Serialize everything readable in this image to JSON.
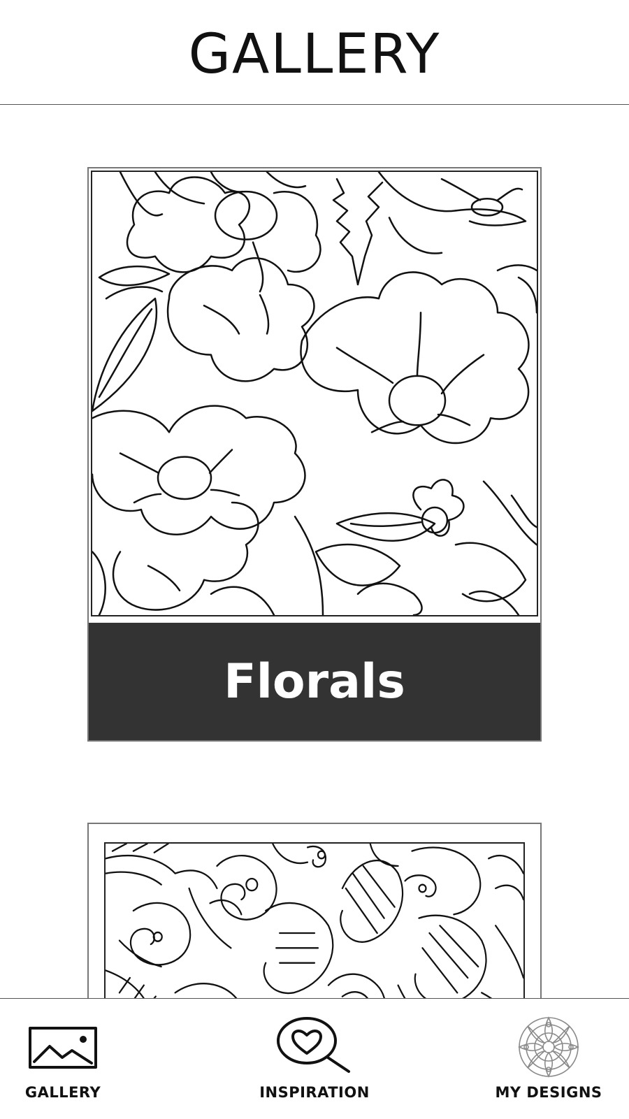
{
  "header": {
    "title": "GALLERY"
  },
  "gallery": {
    "cards": [
      {
        "label": "Florals",
        "icon": "florals-line-art"
      },
      {
        "label": "",
        "icon": "paisley-line-art"
      }
    ]
  },
  "bottom_nav": {
    "items": [
      {
        "label": "GALLERY",
        "icon": "gallery-image-icon"
      },
      {
        "label": "INSPIRATION",
        "icon": "heart-magnifier-icon"
      },
      {
        "label": "MY DESIGNS",
        "icon": "mandala-icon"
      }
    ]
  },
  "colors": {
    "label_background": "#333333",
    "label_text": "#ffffff",
    "line_art": "#111111"
  }
}
